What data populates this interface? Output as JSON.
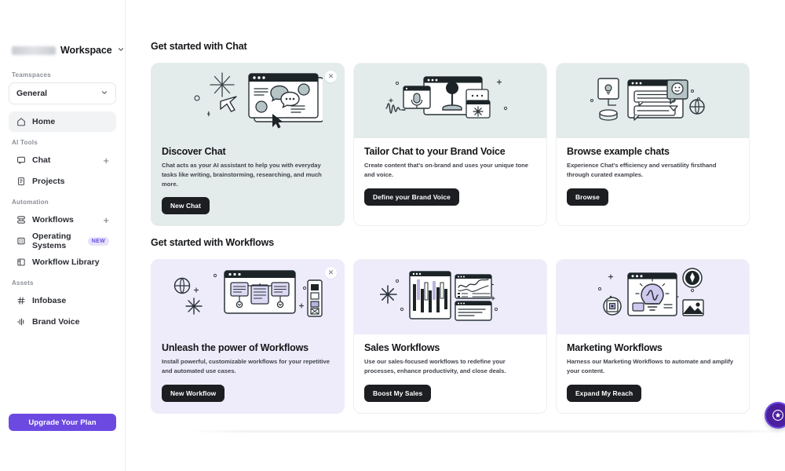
{
  "sidebar": {
    "workspace": {
      "name": "Workspace",
      "redacted": true,
      "caret": "chevron-down-icon"
    },
    "teamspaces_label": "Teamspaces",
    "teamspace_selected": "General",
    "home": {
      "label": "Home",
      "icon": "home-icon"
    },
    "groups": [
      {
        "label": "AI Tools",
        "items": [
          {
            "label": "Chat",
            "icon": "chat-bubble-icon",
            "action": "+"
          },
          {
            "label": "Projects",
            "icon": "document-icon",
            "action": ""
          }
        ]
      },
      {
        "label": "Automation",
        "items": [
          {
            "label": "Workflows",
            "icon": "workflow-icon",
            "action": "+"
          },
          {
            "label": "Operating Systems",
            "icon": "operating-system-icon",
            "action": "",
            "badge": "NEW"
          },
          {
            "label": "Workflow Library",
            "icon": "library-icon",
            "action": ""
          }
        ]
      },
      {
        "label": "Assets",
        "items": [
          {
            "label": "Infobase",
            "icon": "hash-icon",
            "action": ""
          },
          {
            "label": "Brand Voice",
            "icon": "waveform-icon",
            "action": ""
          }
        ]
      }
    ],
    "upgrade_label": "Upgrade Your Plan"
  },
  "colors": {
    "accent_purple": "#6c4ae2",
    "badge_bg": "#e7e2fb",
    "chat_card_bg": "#e3ebeb",
    "workflow_card_bg": "#eeecfb",
    "button_dark": "#1d1e21"
  },
  "main": {
    "sections": [
      {
        "title": "Get started with Chat",
        "cards": [
          {
            "title": "Discover Chat",
            "desc": "Chat acts as your AI assistant to help you with everyday tasks like writing, brainstorming, researching, and much more.",
            "button": "New Chat",
            "art": "chat-window-illustration",
            "style": "solid",
            "tint": "#e3ebeb",
            "close": "close-icon"
          },
          {
            "title": "Tailor Chat to your Brand Voice",
            "desc": "Create content that's on-brand and uses your unique tone and voice.",
            "button": "Define your Brand Voice",
            "art": "microphone-illustration",
            "style": "split",
            "tint": "#e3ebeb",
            "close": "close-icon"
          },
          {
            "title": "Browse example chats",
            "desc": "Experience Chat's efficiency and versatility firsthand through curated examples.",
            "button": "Browse",
            "art": "example-chats-illustration",
            "style": "split",
            "tint": "#e3ebeb",
            "close": "close-icon"
          }
        ]
      },
      {
        "title": "Get started with Workflows",
        "cards": [
          {
            "title": "Unleash the power of Workflows",
            "desc": "Install powerful, customizable workflows for your repetitive and automated use cases.",
            "button": "New Workflow",
            "art": "workflow-diagram-illustration",
            "style": "solid",
            "tint": "#eeecfb",
            "close": "close-icon"
          },
          {
            "title": "Sales Workflows",
            "desc": "Use our sales-focused workflows to redefine your processes, enhance productivity, and close deals.",
            "button": "Boost My Sales",
            "art": "sales-charts-illustration",
            "style": "split",
            "tint": "#eeecfb",
            "close": "close-icon"
          },
          {
            "title": "Marketing Workflows",
            "desc": "Harness our Marketing Workflows to automate and amplify your content.",
            "button": "Expand My Reach",
            "art": "marketing-bulb-illustration",
            "style": "split",
            "tint": "#eeecfb",
            "close": "close-icon"
          }
        ]
      }
    ],
    "fab": "help-widget-icon"
  }
}
